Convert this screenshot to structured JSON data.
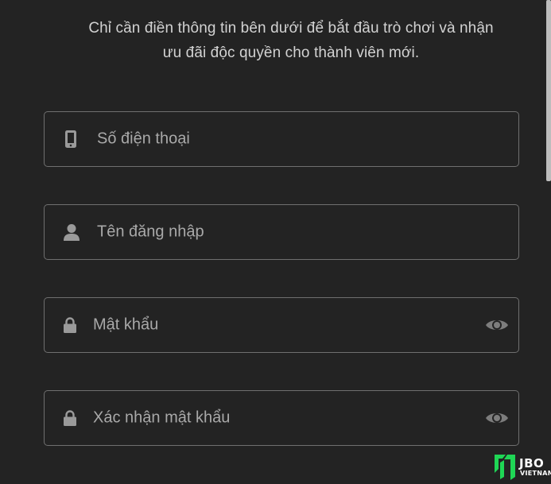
{
  "intro": {
    "line1": "Chỉ cần điền thông tin bên dưới để bắt đầu trò chơi và nhận",
    "line2": "ưu đãi độc quyền cho thành viên mới."
  },
  "form": {
    "phone": {
      "placeholder": "Số điện thoại",
      "icon": "phone-icon"
    },
    "username": {
      "placeholder": "Tên đăng nhập",
      "icon": "user-icon"
    },
    "password": {
      "placeholder": "Mật khẩu",
      "icon": "lock-icon",
      "toggle_icon": "eye-icon"
    },
    "confirm_password": {
      "placeholder": "Xác nhận mật khẩu",
      "icon": "lock-icon",
      "toggle_icon": "eye-icon"
    }
  },
  "watermark": {
    "brand": "JBO",
    "sub": "VIETNAM"
  },
  "colors": {
    "background": "#232323",
    "border": "#6f6f6f",
    "placeholder": "#a9a9a9",
    "logo_green": "#1fd655"
  }
}
